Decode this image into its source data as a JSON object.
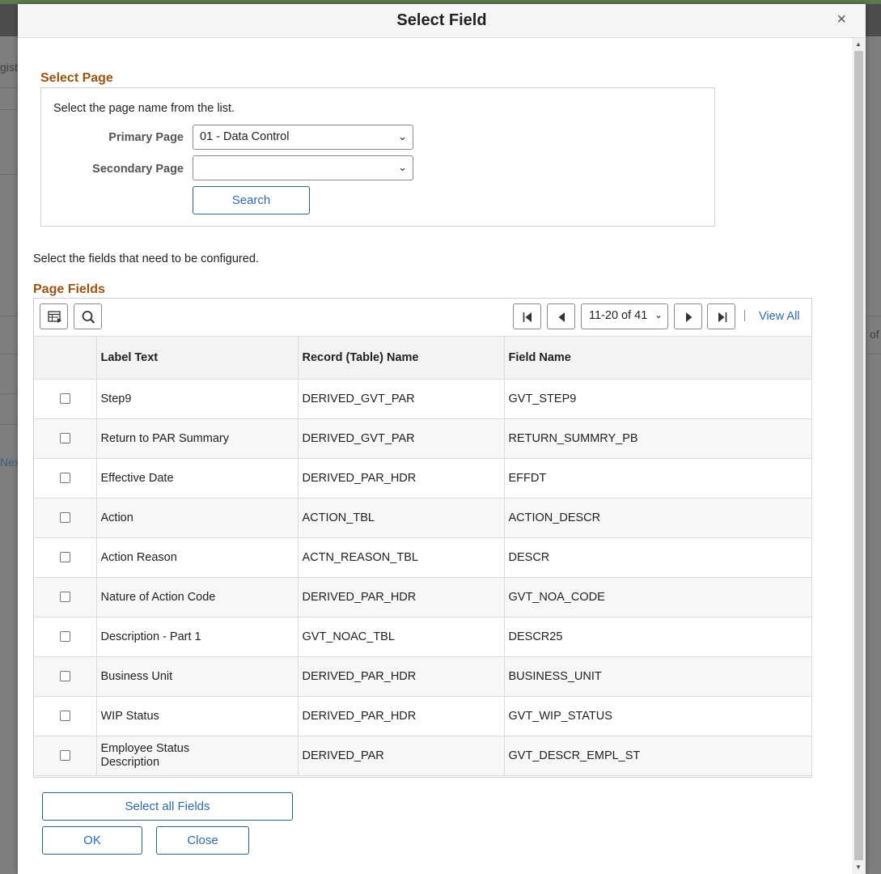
{
  "background": {
    "fragment_top": "gist",
    "fragment_mid": "of",
    "fragment_next": "Nex"
  },
  "modal": {
    "title": "Select Field",
    "close_glyph": "×"
  },
  "select_page": {
    "title": "Select Page",
    "instruction": "Select the page name from the list.",
    "primary_label": "Primary Page",
    "primary_value": "01 - Data Control",
    "secondary_label": "Secondary Page",
    "secondary_value": "",
    "search_label": "Search"
  },
  "fields_instruction": "Select the fields that need to be configured.",
  "page_fields": {
    "title": "Page Fields",
    "toolbar": {
      "personalize_icon": "grid-personalize-icon",
      "find_icon": "search-icon",
      "range": "11-20 of 41",
      "view_all": "View All"
    },
    "columns": [
      "",
      "Label Text",
      "Record (Table) Name",
      "Field Name"
    ],
    "rows": [
      {
        "label": "Step9",
        "record": "DERIVED_GVT_PAR",
        "field": "GVT_STEP9"
      },
      {
        "label": "Return to PAR Summary",
        "record": "DERIVED_GVT_PAR",
        "field": "RETURN_SUMMRY_PB"
      },
      {
        "label": "Effective Date",
        "record": "DERIVED_PAR_HDR",
        "field": "EFFDT"
      },
      {
        "label": "Action",
        "record": "ACTION_TBL",
        "field": "ACTION_DESCR"
      },
      {
        "label": "Action Reason",
        "record": "ACTN_REASON_TBL",
        "field": "DESCR"
      },
      {
        "label": "Nature of Action Code",
        "record": "DERIVED_PAR_HDR",
        "field": "GVT_NOA_CODE"
      },
      {
        "label": "Description - Part 1",
        "record": "GVT_NOAC_TBL",
        "field": "DESCR25"
      },
      {
        "label": "Business Unit",
        "record": "DERIVED_PAR_HDR",
        "field": "BUSINESS_UNIT"
      },
      {
        "label": "WIP Status",
        "record": "DERIVED_PAR_HDR",
        "field": "GVT_WIP_STATUS"
      },
      {
        "label": "Employee Status Description",
        "record": "DERIVED_PAR",
        "field": "GVT_DESCR_EMPL_ST"
      }
    ]
  },
  "buttons": {
    "select_all": "Select all Fields",
    "ok": "OK",
    "close": "Close"
  }
}
